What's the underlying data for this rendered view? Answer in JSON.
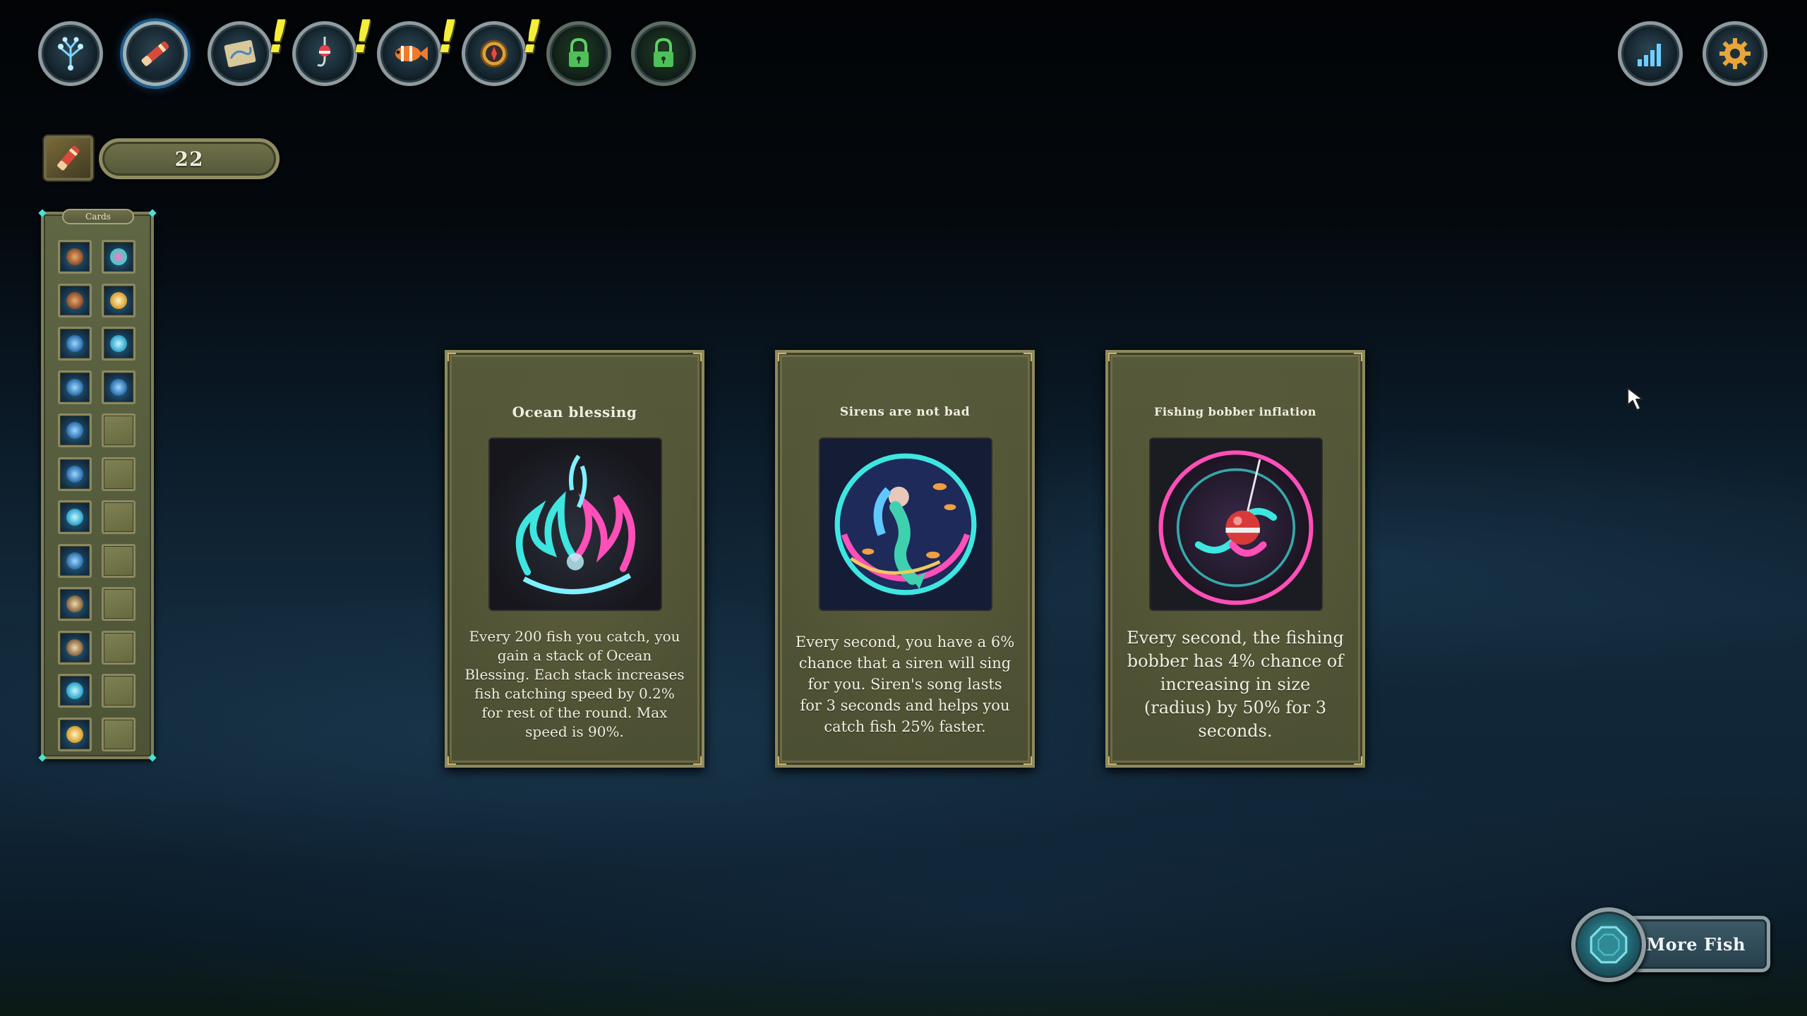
{
  "top_bar": {
    "left_buttons": [
      {
        "icon": "skill-tree-icon",
        "alert": false,
        "active": false,
        "locked": false
      },
      {
        "icon": "rod-icon",
        "alert": false,
        "active": true,
        "locked": false
      },
      {
        "icon": "map-icon",
        "alert": true,
        "active": false,
        "locked": false
      },
      {
        "icon": "bobber-hook-icon",
        "alert": true,
        "active": false,
        "locked": false
      },
      {
        "icon": "clownfish-icon",
        "alert": true,
        "active": false,
        "locked": false
      },
      {
        "icon": "compass-icon",
        "alert": true,
        "active": false,
        "locked": false
      },
      {
        "icon": "padlock-icon",
        "alert": false,
        "active": false,
        "locked": true
      },
      {
        "icon": "padlock-icon",
        "alert": false,
        "active": false,
        "locked": true
      }
    ],
    "alert_mark": "!",
    "right_buttons": [
      {
        "icon": "stats-icon"
      },
      {
        "icon": "gear-icon"
      }
    ]
  },
  "currency": {
    "icon": "rod-icon",
    "value": "22"
  },
  "cards_panel": {
    "title": "Cards",
    "slots": [
      {
        "filled": true,
        "color": "orange"
      },
      {
        "filled": true,
        "color": "pink"
      },
      {
        "filled": true,
        "color": "orange"
      },
      {
        "filled": true,
        "color": "gold"
      },
      {
        "filled": true,
        "color": "blue"
      },
      {
        "filled": true,
        "color": "cyan"
      },
      {
        "filled": true,
        "color": "blue"
      },
      {
        "filled": true,
        "color": "blue"
      },
      {
        "filled": true,
        "color": "blue"
      },
      {
        "filled": false
      },
      {
        "filled": true,
        "color": "blue"
      },
      {
        "filled": false
      },
      {
        "filled": true,
        "color": "cyan"
      },
      {
        "filled": false
      },
      {
        "filled": true,
        "color": "blue"
      },
      {
        "filled": false
      },
      {
        "filled": true,
        "color": "sand"
      },
      {
        "filled": false
      },
      {
        "filled": true,
        "color": "sand"
      },
      {
        "filled": false
      },
      {
        "filled": true,
        "color": "cyan"
      },
      {
        "filled": false
      },
      {
        "filled": true,
        "color": "gold"
      },
      {
        "filled": false
      }
    ]
  },
  "choices": [
    {
      "title": "Ocean blessing",
      "art": "ocean-blessing-art",
      "description": "Every 200 fish you catch, you gain a stack of Ocean Blessing. Each stack increases fish catching speed by 0.2% for rest of the round. Max speed is 90%."
    },
    {
      "title": "Sirens are not bad",
      "art": "siren-art",
      "description": "Every second, you have a 6% chance that a siren will sing for you. Siren's song lasts for 3 seconds and helps you catch fish 25% faster."
    },
    {
      "title": "Fishing bobber inflation",
      "art": "bobber-inflation-art",
      "description": "Every second, the fishing bobber has 4% chance of increasing in size (radius) by 50% for 3 seconds."
    }
  ],
  "more_fish_button": {
    "label": "More Fish",
    "icon": "octagon-orb-icon"
  },
  "colors": {
    "panel_olive": "#56593a",
    "panel_border": "#8e8a5d",
    "alert_yellow": "#f4ee3a",
    "neon_cyan": "#3ee6e0",
    "neon_pink": "#ff4fb8"
  }
}
